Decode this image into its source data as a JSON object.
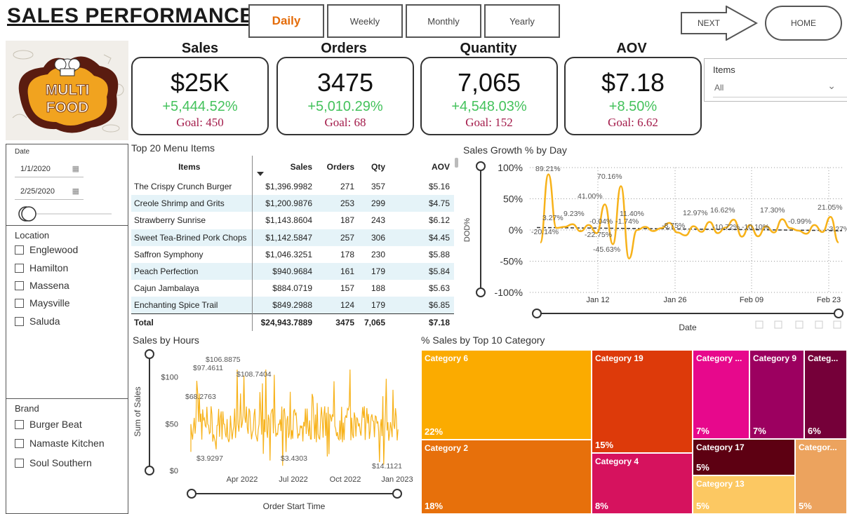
{
  "header": {
    "title": "SALES PERFORMANCE",
    "tabs": [
      {
        "label": "Daily",
        "active": true
      },
      {
        "label": "Weekly",
        "active": false
      },
      {
        "label": "Monthly",
        "active": false
      },
      {
        "label": "Yearly",
        "active": false
      }
    ],
    "next_label": "NEXT",
    "home_label": "HOME"
  },
  "logo": {
    "line1": "MULTI",
    "line2": "FOOD"
  },
  "kpis": [
    {
      "title": "Sales",
      "value": "$25K",
      "change": "+5,444.52%",
      "goal": "Goal: 450"
    },
    {
      "title": "Orders",
      "value": "3475",
      "change": "+5,010.29%",
      "goal": "Goal: 68"
    },
    {
      "title": "Quantity",
      "value": "7,065",
      "change": "+4,548.03%",
      "goal": "Goal: 152"
    },
    {
      "title": "AOV",
      "value": "$7.18",
      "change": "+8.50%",
      "goal": "Goal: 6.62"
    }
  ],
  "items_slicer": {
    "label": "Items",
    "value": "All"
  },
  "date_slicer": {
    "label": "Date",
    "start": "1/1/2020",
    "end": "2/25/2020"
  },
  "location_slicer": {
    "label": "Location",
    "options": [
      "Englewood",
      "Hamilton",
      "Massena",
      "Maysville",
      "Saluda"
    ]
  },
  "brand_slicer": {
    "label": "Brand",
    "options": [
      "Burger Beat",
      "Namaste Kitchen",
      "Soul Southern"
    ]
  },
  "menu_table": {
    "title": "Top 20 Menu Items",
    "columns": [
      "Items",
      "Sales",
      "Orders",
      "Qty",
      "AOV"
    ],
    "rows": [
      [
        "The Crispy Crunch Burger",
        "$1,396.9982",
        "271",
        "357",
        "$5.16"
      ],
      [
        "Creole Shrimp and Grits",
        "$1,200.9876",
        "253",
        "299",
        "$4.75"
      ],
      [
        "Strawberry Sunrise",
        "$1,143.8604",
        "187",
        "243",
        "$6.12"
      ],
      [
        "Sweet Tea-Brined Pork Chops",
        "$1,142.5847",
        "257",
        "306",
        "$4.45"
      ],
      [
        "Saffron Symphony",
        "$1,046.3251",
        "178",
        "230",
        "$5.88"
      ],
      [
        "Peach Perfection",
        "$940.9684",
        "161",
        "179",
        "$5.84"
      ],
      [
        "Cajun Jambalaya",
        "$884.0719",
        "157",
        "188",
        "$5.63"
      ],
      [
        "Enchanting Spice Trail",
        "$849.2988",
        "124",
        "179",
        "$6.85"
      ]
    ],
    "total": [
      "Total",
      "$24,943.7889",
      "3475",
      "7,065",
      "$7.18"
    ]
  },
  "chart_data": [
    {
      "type": "line",
      "title": "Sales Growth % by Day",
      "xlabel": "Date",
      "ylabel": "DOD%",
      "x_ticks": [
        "Jan 12",
        "Jan 26",
        "Feb 09",
        "Feb 23"
      ],
      "y_ticks": [
        "100%",
        "50%",
        "0%",
        "-50%",
        "-100%"
      ],
      "ylim": [
        -100,
        100
      ],
      "grid": true,
      "series": [
        {
          "values": [
            -20.14,
            89.21,
            3.27,
            5.0,
            9.23,
            -2.0,
            8.0,
            -5.0,
            41.0,
            -22.75,
            70.16,
            -45.63,
            0.04,
            5.0,
            -1.74,
            3.0,
            11.4,
            -4.0,
            -8.75,
            6.0,
            -3.0,
            12.97,
            -5.0,
            4.0,
            16.62,
            -10.72,
            8.0,
            -10.1,
            6.0,
            -4.0,
            17.3,
            3.0,
            -0.99,
            -6.0,
            8.0,
            -3.27,
            21.05,
            -20.0
          ]
        }
      ],
      "data_labels": [
        "89.21%",
        "70.16%",
        "41.00%",
        "3.27%",
        "9.23%",
        "-20.14%",
        "-22.75%",
        "-45.63%",
        "-0.04%",
        "-1.74%",
        "11.40%",
        "-8.75%",
        "12.97%",
        "16.62%",
        "-10.72%",
        "-10.10%",
        "17.30%",
        "-0.99%",
        "21.05%",
        "-3.27%"
      ]
    },
    {
      "type": "area",
      "title": "Sales by Hours",
      "xlabel": "Order Start Time",
      "ylabel": "Sum of Sales",
      "x_ticks": [
        "Apr 2022",
        "Jul 2022",
        "Oct 2022",
        "Jan 2023"
      ],
      "y_ticks": [
        "$100",
        "$50",
        "$0"
      ],
      "ylim": [
        0,
        120
      ],
      "data_labels": [
        "$106.8875",
        "$97.4611",
        "$108.7404",
        "$68.2763",
        "$3.9297",
        "$3.4303",
        "$14.1121"
      ]
    },
    {
      "type": "treemap",
      "title": "% Sales by Top 10 Category",
      "series": [
        {
          "name": "Category 6",
          "value": 22,
          "label": "22%",
          "color": "#fbab00"
        },
        {
          "name": "Category 2",
          "value": 18,
          "label": "18%",
          "color": "#e7700b"
        },
        {
          "name": "Category 19",
          "value": 15,
          "label": "15%",
          "color": "#dd3a0a"
        },
        {
          "name": "Category 4",
          "value": 8,
          "label": "8%",
          "color": "#d6125e"
        },
        {
          "name": "Category ...",
          "value": 7,
          "label": "7%",
          "color": "#e7088c"
        },
        {
          "name": "Category 9",
          "value": 7,
          "label": "7%",
          "color": "#9c0060"
        },
        {
          "name": "Categ...",
          "value": 6,
          "label": "6%",
          "color": "#750039"
        },
        {
          "name": "Category 17",
          "value": 5,
          "label": "5%",
          "color": "#5d0012"
        },
        {
          "name": "Category 13",
          "value": 5,
          "label": "5%",
          "color": "#fcc862"
        },
        {
          "name": "Categor...",
          "value": 5,
          "label": "5%",
          "color": "#eca35e"
        }
      ]
    }
  ],
  "colors": {
    "accent": "#e46c0a",
    "positive": "#44c25c",
    "goal": "#a31b4a",
    "line": "#f7b21a",
    "table_stripe": "#e5f3f8"
  }
}
